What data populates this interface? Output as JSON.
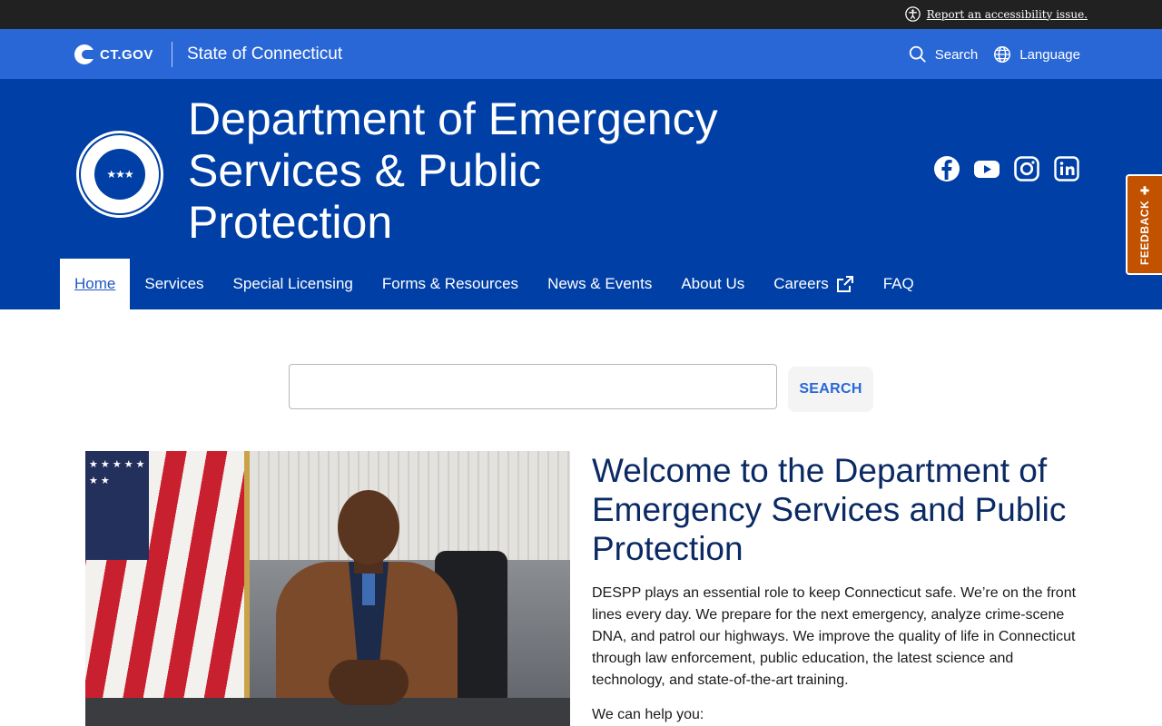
{
  "utility_bar": {
    "accessibility_link": "Report an accessibility issue."
  },
  "ct_bar": {
    "logo_text": "CT.GOV",
    "state_name": "State of Connecticut",
    "search_label": "Search",
    "language_label": "Language"
  },
  "agency": {
    "title": "Department of Emergency Services & Public Protection",
    "social": [
      "facebook-icon",
      "youtube-icon",
      "instagram-icon",
      "linkedin-icon"
    ]
  },
  "nav": {
    "items": [
      {
        "label": "Home",
        "active": true
      },
      {
        "label": "Services"
      },
      {
        "label": "Special Licensing"
      },
      {
        "label": "Forms & Resources"
      },
      {
        "label": "News & Events"
      },
      {
        "label": "About Us"
      },
      {
        "label": "Careers",
        "external": true
      },
      {
        "label": "FAQ"
      }
    ]
  },
  "feedback": {
    "label": "FEEDBACK ✚"
  },
  "search": {
    "value": "",
    "button_label": "SEARCH"
  },
  "welcome": {
    "title": "Welcome to the Department of Emergency Services and Public Protection",
    "body": "DESPP plays an essential role to keep Connecticut safe. We’re on the front lines every day. We prepare for the next emergency, analyze crime-scene DNA, and patrol our highways. We improve the quality of life in Connecticut through law enforcement, public education, the latest science and technology, and state-of-the-art training.",
    "help_intro": "We can help you:"
  },
  "colors": {
    "utility_bar": "#212121",
    "ct_bar": "#2a67d6",
    "agency_header": "#003fa5",
    "feedback_tab": "#c25100",
    "heading": "#0b2a63"
  }
}
